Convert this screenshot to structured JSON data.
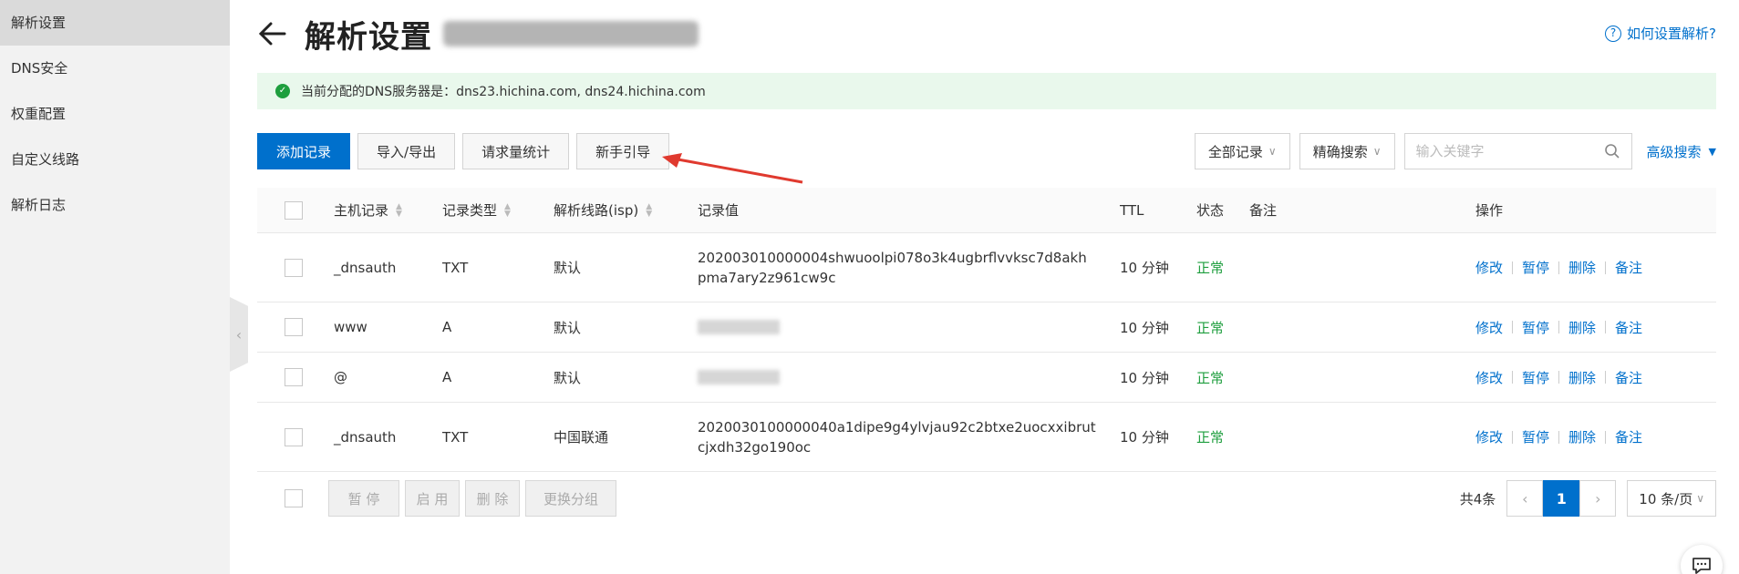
{
  "sidebar": {
    "items": [
      {
        "label": "解析设置"
      },
      {
        "label": "DNS安全"
      },
      {
        "label": "权重配置"
      },
      {
        "label": "自定义线路"
      },
      {
        "label": "解析日志"
      }
    ]
  },
  "header": {
    "title": "解析设置",
    "help": "如何设置解析?"
  },
  "dns_notice": {
    "text": "当前分配的DNS服务器是：dns23.hichina.com, dns24.hichina.com"
  },
  "toolbar": {
    "add": "添加记录",
    "import_export": "导入/导出",
    "stats": "请求量统计",
    "guide": "新手引导"
  },
  "filters": {
    "record_filter": "全部记录",
    "search_mode": "精确搜索",
    "search_placeholder": "输入关键字",
    "advanced": "高级搜索"
  },
  "table": {
    "headers": {
      "host": "主机记录",
      "type": "记录类型",
      "line": "解析线路(isp)",
      "value": "记录值",
      "ttl": "TTL",
      "status": "状态",
      "remark": "备注",
      "ops": "操作"
    },
    "ops_labels": {
      "edit": "修改",
      "pause": "暂停",
      "delete": "删除",
      "remark": "备注"
    },
    "rows": [
      {
        "host": "_dnsauth",
        "type": "TXT",
        "line": "默认",
        "value1": "202003010000004shwuoolpi078o3k4ugbrflvvksc7d8akh",
        "value2": "pma7ary2z961cw9c",
        "ttl": "10 分钟",
        "status": "正常"
      },
      {
        "host": "www",
        "type": "A",
        "line": "默认",
        "ttl": "10 分钟",
        "status": "正常"
      },
      {
        "host": "@",
        "type": "A",
        "line": "默认",
        "ttl": "10 分钟",
        "status": "正常"
      },
      {
        "host": "_dnsauth",
        "type": "TXT",
        "line": "中国联通",
        "value1": "2020030100000040a1dipe9g4ylvjau92c2btxe2uocxxibrut",
        "value2": "cjxdh32go190oc",
        "ttl": "10 分钟",
        "status": "正常"
      }
    ]
  },
  "footer": {
    "pause": "暂 停",
    "enable": "启 用",
    "delete": "删 除",
    "change_group": "更换分组",
    "total": "共4条",
    "current_page": "1",
    "page_size": "10 条/页"
  },
  "colors": {
    "primary": "#0070cc",
    "success": "#1e9e3e",
    "notice_bg": "#e9f8ec"
  }
}
